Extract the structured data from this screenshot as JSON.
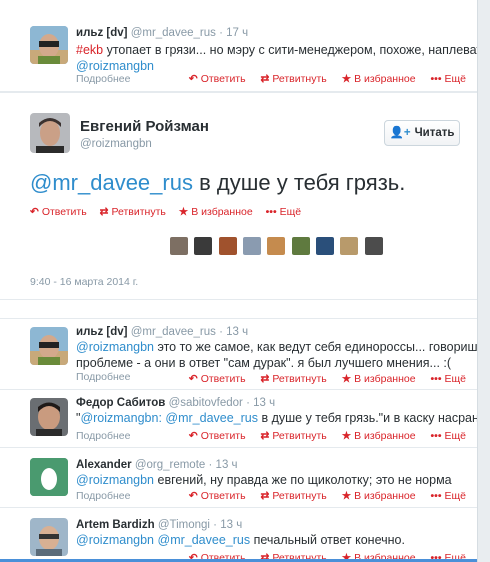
{
  "colors": {
    "link": "#2f8dcc",
    "action": "#d9242a",
    "muted": "#8899a6",
    "text": "#292f33"
  },
  "actions": {
    "reply": "Ответить",
    "retweet": "Ретвитнуть",
    "favorite": "В избранное",
    "more": "Ещё",
    "details": "Подробнее"
  },
  "icons": {
    "reply": "reply-arrow-icon",
    "retweet": "retweet-icon",
    "favorite": "star-icon",
    "more": "dots-icon",
    "follow": "add-user-icon"
  },
  "top_tweet": {
    "name": "ильz [dv]",
    "handle": "@mr_davee_rus",
    "sep": "·",
    "time": "17 ч",
    "hashtag": "#ekb",
    "text": " утопает в грязи... но мэру с сити-менеджером, похоже, наплевать :\\ //",
    "mention": "@roizmangbn"
  },
  "main": {
    "name": "Евгений Ройзман",
    "handle": "@roizmangbn",
    "follow_label": "Читать",
    "mention": "@mr_davee_rus",
    "text": " в душе у тебя грязь.",
    "timestamp": "9:40 - 16 марта 2014 г."
  },
  "replies": [
    {
      "name": "ильz [dv]",
      "handle": "@mr_davee_rus",
      "time": "13 ч",
      "line1_mention": "@roizmangbn",
      "line1_text": " это то же самое, как ведут себя единороссы... говоришь им о",
      "line2_text": "проблеме - а они в ответ \"сам дурак\". я был лучшего мнения... :("
    },
    {
      "name": "Федор Сабитов",
      "handle": "@sabitovfedor",
      "time": "13 ч",
      "quote_open": "\"",
      "m1": "@roizmangbn:",
      "m2": "@mr_davee_rus",
      "text": " в душе у тебя грязь.\"и в каску насрано?)))"
    },
    {
      "name": "Alexander",
      "handle": "@org_remote",
      "time": "13 ч",
      "m1": "@roizmangbn",
      "text": " евгений, ну правда же по щиколотку; это не норма"
    },
    {
      "name": "Artem Bardizh",
      "handle": "@Timongi",
      "time": "13 ч",
      "m1": "@roizmangbn",
      "m2": "@mr_davee_rus",
      "text": " печальный ответ конечно."
    }
  ]
}
